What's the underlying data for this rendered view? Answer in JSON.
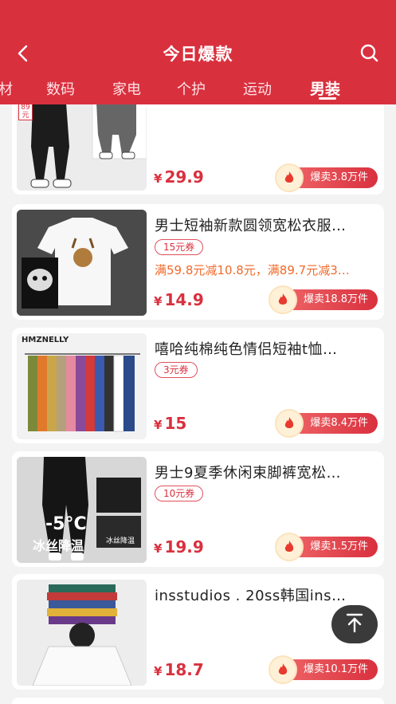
{
  "header": {
    "title": "今日爆款",
    "back_icon": "back-icon",
    "search_icon": "search-icon",
    "background": "#d9303e"
  },
  "tabs": [
    {
      "label": "材"
    },
    {
      "label": "数码"
    },
    {
      "label": "家电"
    },
    {
      "label": "个护"
    },
    {
      "label": "运动"
    },
    {
      "label": "男装",
      "active": true
    }
  ],
  "products": [
    {
      "title": "",
      "price": "29.9",
      "currency": "¥",
      "sold": "爆卖3.8万件",
      "thumb_badge": "89元"
    },
    {
      "title": "男士短袖新款圆领宽松衣服…",
      "coupon": "15元券",
      "promo": "满59.8元减10.8元，满89.7元减3…",
      "price": "14.9",
      "currency": "¥",
      "sold": "爆卖18.8万件"
    },
    {
      "title": "嘻哈纯棉纯色情侣短袖t恤…",
      "coupon": "3元券",
      "price": "15",
      "currency": "¥",
      "sold": "爆卖8.4万件",
      "thumb_brand": "HMZNELLY"
    },
    {
      "title": "男士9夏季休闲束脚裤宽松…",
      "coupon": "10元券",
      "price": "19.9",
      "currency": "¥",
      "sold": "爆卖1.5万件",
      "thumb_text1": "-5°C",
      "thumb_text2": "冰丝降温",
      "thumb_text3": "冰丝降温"
    },
    {
      "title": "insstudios . 20ss韩国ins…",
      "price": "18.7",
      "currency": "¥",
      "sold": "爆卖10.1万件"
    }
  ],
  "float_button": {
    "icon": "back-to-top-icon"
  },
  "colors": {
    "accent": "#d9303e",
    "promo": "#f06a2a"
  }
}
